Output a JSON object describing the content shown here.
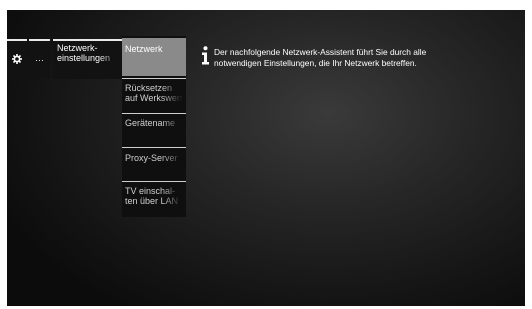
{
  "breadcrumb": {
    "dots": "···",
    "current_line1": "Netzwerk-",
    "current_line2": "einstellungen"
  },
  "menu": {
    "items": [
      {
        "line1": "Netzwerk",
        "line2": ""
      },
      {
        "line1": "Rücksetzen",
        "line2": "auf Werkswerte"
      },
      {
        "line1": "Gerätename",
        "line2": ""
      },
      {
        "line1": "Proxy-Server",
        "line2": ""
      },
      {
        "line1": "TV einschal-",
        "line2": "ten über LAN"
      }
    ]
  },
  "info": {
    "text": "Der nachfolgende Netzwerk-Assistent führt Sie durch alle\nnotwendigen Einstellungen, die Ihr Netzwerk betreffen."
  },
  "colors": {
    "selected_bg": "#8a8a8a",
    "menu_bg": "#0f0f0f",
    "screen_bg": "#1e1e1e"
  }
}
